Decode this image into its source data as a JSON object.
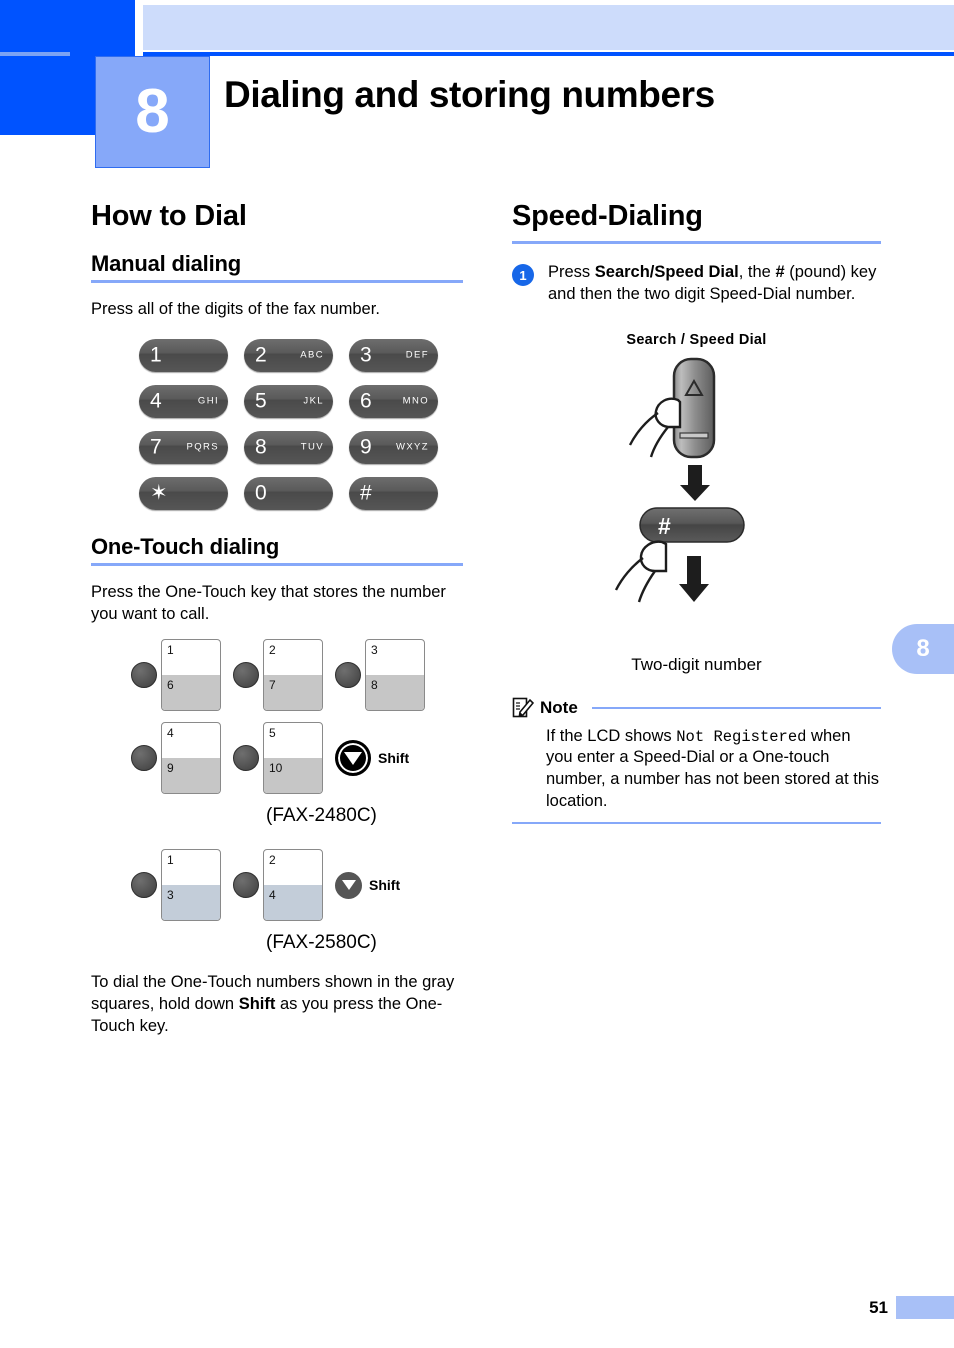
{
  "header": {
    "chapter_number": "8",
    "chapter_title": "Dialing and storing numbers"
  },
  "left_column": {
    "section_title": "How to Dial",
    "manual": {
      "heading": "Manual dialing",
      "body": "Press all of the digits of the fax number."
    },
    "dialpad": {
      "rows": [
        [
          {
            "digit": "1",
            "letters": ""
          },
          {
            "digit": "2",
            "letters": "ABC"
          },
          {
            "digit": "3",
            "letters": "DEF"
          }
        ],
        [
          {
            "digit": "4",
            "letters": "GHI"
          },
          {
            "digit": "5",
            "letters": "JKL"
          },
          {
            "digit": "6",
            "letters": "MNO"
          }
        ],
        [
          {
            "digit": "7",
            "letters": "PQRS"
          },
          {
            "digit": "8",
            "letters": "TUV"
          },
          {
            "digit": "9",
            "letters": "WXYZ"
          }
        ],
        [
          {
            "digit": "✶",
            "letters": ""
          },
          {
            "digit": "0",
            "letters": ""
          },
          {
            "digit": "#",
            "letters": ""
          }
        ]
      ]
    },
    "onetouch": {
      "heading": "One-Touch dialing",
      "body": "Press the One-Touch key that stores the number you want to call.",
      "model_2480c": {
        "label": "(FAX-2480C)",
        "shift_label": "Shift",
        "rows": [
          [
            {
              "top": "1",
              "bottom": "6"
            },
            {
              "top": "2",
              "bottom": "7"
            },
            {
              "top": "3",
              "bottom": "8"
            }
          ],
          [
            {
              "top": "4",
              "bottom": "9"
            },
            {
              "top": "5",
              "bottom": "10"
            }
          ]
        ]
      },
      "model_2580c": {
        "label": "(FAX-2580C)",
        "shift_label": "Shift",
        "rows": [
          [
            {
              "top": "1",
              "bottom": "3"
            },
            {
              "top": "2",
              "bottom": "4"
            }
          ]
        ]
      },
      "footnote_1": "To dial the One-Touch numbers shown in the",
      "footnote_2a": "gray squares, hold down ",
      "footnote_2b": "Shift",
      "footnote_2c": " as you press",
      "footnote_3": "the One-Touch key."
    }
  },
  "right_column": {
    "section_title": "Speed-Dialing",
    "step1": {
      "number": "1",
      "t1": "Press ",
      "t2": "Search/Speed Dial",
      "t3": ", the ",
      "t4": "#",
      "t5": " (pound) key and then the two digit Speed-Dial number."
    },
    "illustration": {
      "top_caption": "Search / Speed Dial",
      "hash_key_label": "#",
      "bottom_caption": "Two-digit number",
      "triangle_glyph": "△"
    },
    "note": {
      "title": "Note",
      "icon": "note-pencil-icon",
      "text_a": "If the LCD shows ",
      "text_mono": "Not Registered",
      "text_b": " when you enter a Speed-Dial or a One-touch number, a number has not been stored at this location."
    }
  },
  "side_tab": {
    "label": "8"
  },
  "footer": {
    "page_number": "51"
  },
  "colors": {
    "brand_blue": "#0053ff",
    "band_blue": "#cddcfb",
    "chapter_blue": "#86a8f9",
    "rule_blue": "#86a8f9",
    "step_blue": "#1767e8",
    "key_gray": "#565656",
    "onetouch_gray": "#c6c6c6",
    "onetouch_bluegray": "#c3cdd9"
  }
}
